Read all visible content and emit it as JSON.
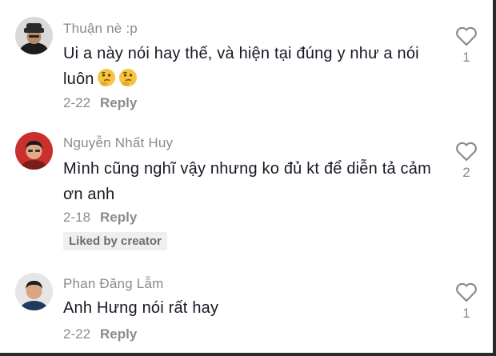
{
  "colors": {
    "background": "#ffffff",
    "username": "#8a8a8e",
    "text": "#161823",
    "badge_bg": "#efefef"
  },
  "comments": [
    {
      "username": "Thuận nè :p",
      "text": "Ui a này nói hay thế, và hiện tại đúng y như a nói luôn",
      "emojis": [
        "thinking-face",
        "thinking-face"
      ],
      "date": "2-22",
      "reply_label": "Reply",
      "like_icon": "heart-outline-icon",
      "like_count": "1"
    },
    {
      "username": "Nguyễn Nhất Huy",
      "text": "Mình cũng nghĩ vậy nhưng ko đủ kt để diễn tả cảm ơn anh",
      "date": "2-18",
      "reply_label": "Reply",
      "badge": "Liked by creator",
      "like_icon": "heart-outline-icon",
      "like_count": "2"
    },
    {
      "username": "Phan Đăng Lẫm",
      "text": "Anh Hưng nói rất hay",
      "date": "2-22",
      "reply_label": "Reply",
      "like_icon": "heart-outline-icon",
      "like_count": "1"
    }
  ]
}
